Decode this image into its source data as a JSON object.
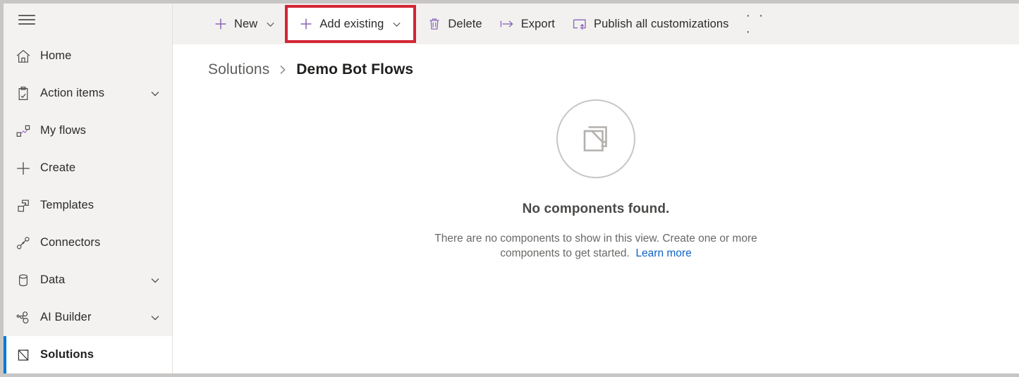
{
  "sidebar": {
    "menu_toggle": "hamburger-menu-icon",
    "items": [
      {
        "label": "Home",
        "icon": "home-icon",
        "chevron": false,
        "selected": false
      },
      {
        "label": "Action items",
        "icon": "clipboard-check-icon",
        "chevron": true,
        "selected": false
      },
      {
        "label": "My flows",
        "icon": "flow-icon",
        "chevron": false,
        "selected": false
      },
      {
        "label": "Create",
        "icon": "plus-icon",
        "chevron": false,
        "selected": false
      },
      {
        "label": "Templates",
        "icon": "templates-icon",
        "chevron": false,
        "selected": false
      },
      {
        "label": "Connectors",
        "icon": "connectors-icon",
        "chevron": false,
        "selected": false
      },
      {
        "label": "Data",
        "icon": "database-icon",
        "chevron": true,
        "selected": false
      },
      {
        "label": "AI Builder",
        "icon": "ai-builder-icon",
        "chevron": true,
        "selected": false
      },
      {
        "label": "Solutions",
        "icon": "solutions-icon",
        "chevron": false,
        "selected": true
      }
    ],
    "selected_accent_color": "#0078d4"
  },
  "command_bar": {
    "accent_icon_color": "#8764b8",
    "highlight_color": "#d32535",
    "commands": [
      {
        "label": "New",
        "icon": "plus-icon",
        "chevron": true,
        "highlighted": false
      },
      {
        "label": "Add existing",
        "icon": "plus-icon",
        "chevron": true,
        "highlighted": true
      },
      {
        "label": "Delete",
        "icon": "trash-icon",
        "chevron": false,
        "highlighted": false
      },
      {
        "label": "Export",
        "icon": "export-arrow-icon",
        "chevron": false,
        "highlighted": false
      },
      {
        "label": "Publish all customizations",
        "icon": "publish-icon",
        "chevron": false,
        "highlighted": false
      }
    ],
    "overflow_label": "· · ·"
  },
  "breadcrumb": {
    "parent": "Solutions",
    "separator": "chevron-right-icon",
    "current": "Demo Bot Flows"
  },
  "empty_state": {
    "illustration": "empty-components-icon",
    "title": "No components found.",
    "description": "There are no components to show in this view. Create one or more components to get started.",
    "link_label": "Learn more",
    "link_color": "#0f62c4"
  }
}
